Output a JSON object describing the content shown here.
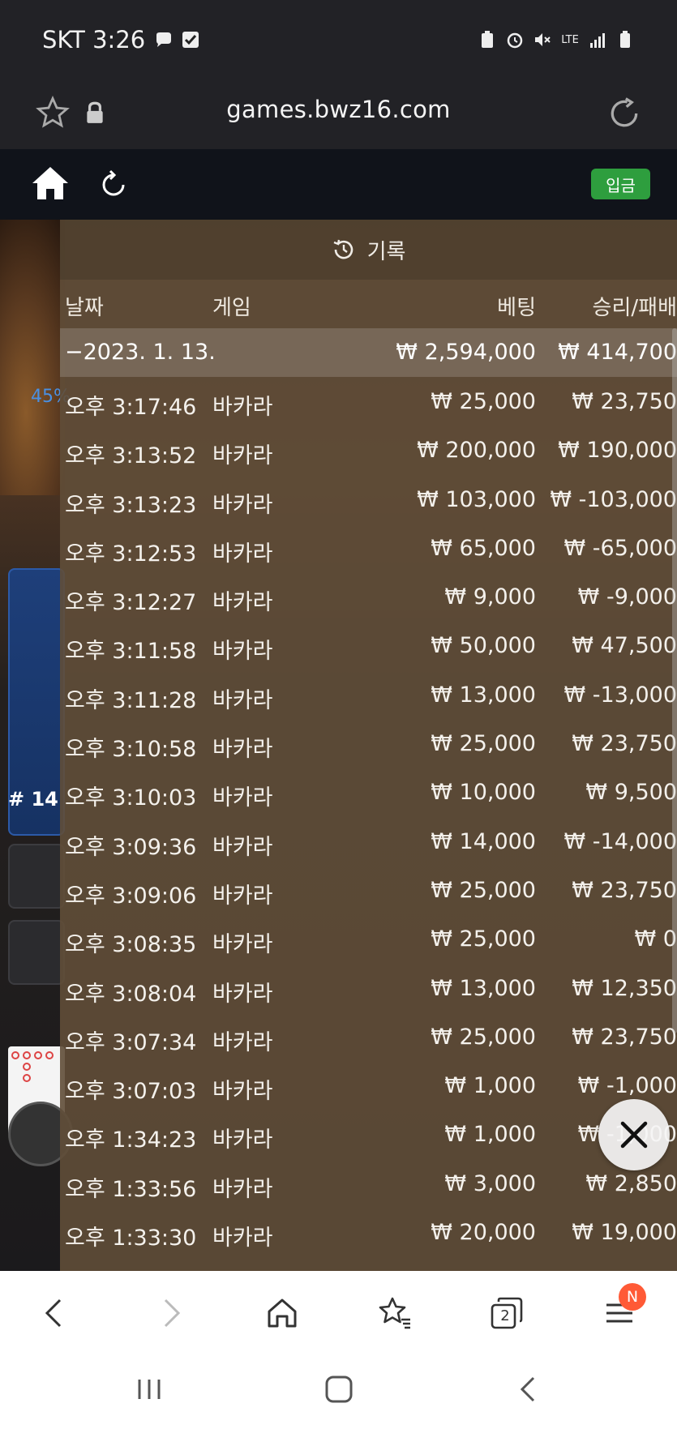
{
  "status_bar": {
    "carrier_time": "SKT 3:26",
    "network": "LTE"
  },
  "url_bar": {
    "url": "games.bwz16.com"
  },
  "toolbar": {
    "deposit_label": "입금"
  },
  "background": {
    "percent": "45%",
    "round_label": "# 14"
  },
  "history": {
    "title": "기록",
    "columns": {
      "date": "날짜",
      "game": "게임",
      "bet": "베팅",
      "win_loss": "승리/패배"
    },
    "summary": {
      "date": "−2023. 1. 13.",
      "bet": "₩ 2,594,000",
      "result": "₩ 414,700"
    },
    "rows": [
      {
        "time": "오후 3:17:46",
        "game": "바카라",
        "bet": "₩ 25,000",
        "result": "₩ 23,750"
      },
      {
        "time": "오후 3:13:52",
        "game": "바카라",
        "bet": "₩ 200,000",
        "result": "₩ 190,000"
      },
      {
        "time": "오후 3:13:23",
        "game": "바카라",
        "bet": "₩ 103,000",
        "result": "₩ -103,000"
      },
      {
        "time": "오후 3:12:53",
        "game": "바카라",
        "bet": "₩ 65,000",
        "result": "₩ -65,000"
      },
      {
        "time": "오후 3:12:27",
        "game": "바카라",
        "bet": "₩ 9,000",
        "result": "₩ -9,000"
      },
      {
        "time": "오후 3:11:58",
        "game": "바카라",
        "bet": "₩ 50,000",
        "result": "₩ 47,500"
      },
      {
        "time": "오후 3:11:28",
        "game": "바카라",
        "bet": "₩ 13,000",
        "result": "₩ -13,000"
      },
      {
        "time": "오후 3:10:58",
        "game": "바카라",
        "bet": "₩ 25,000",
        "result": "₩ 23,750"
      },
      {
        "time": "오후 3:10:03",
        "game": "바카라",
        "bet": "₩ 10,000",
        "result": "₩ 9,500"
      },
      {
        "time": "오후 3:09:36",
        "game": "바카라",
        "bet": "₩ 14,000",
        "result": "₩ -14,000"
      },
      {
        "time": "오후 3:09:06",
        "game": "바카라",
        "bet": "₩ 25,000",
        "result": "₩ 23,750"
      },
      {
        "time": "오후 3:08:35",
        "game": "바카라",
        "bet": "₩ 25,000",
        "result": "₩ 0"
      },
      {
        "time": "오후 3:08:04",
        "game": "바카라",
        "bet": "₩ 13,000",
        "result": "₩ 12,350"
      },
      {
        "time": "오후 3:07:34",
        "game": "바카라",
        "bet": "₩ 25,000",
        "result": "₩ 23,750"
      },
      {
        "time": "오후 3:07:03",
        "game": "바카라",
        "bet": "₩ 1,000",
        "result": "₩ -1,000"
      },
      {
        "time": "오후 1:34:23",
        "game": "바카라",
        "bet": "₩ 1,000",
        "result": "₩ -1,000"
      },
      {
        "time": "오후 1:33:56",
        "game": "바카라",
        "bet": "₩ 3,000",
        "result": "₩ 2,850"
      },
      {
        "time": "오후 1:33:30",
        "game": "바카라",
        "bet": "₩ 20,000",
        "result": "₩ 19,000"
      }
    ]
  },
  "bottom_nav": {
    "tab_count": "2",
    "badge": "N"
  },
  "colors": {
    "deposit_green": "#2e9e3e",
    "overlay_brown": "#604e38",
    "badge_orange": "#ff5a36"
  }
}
